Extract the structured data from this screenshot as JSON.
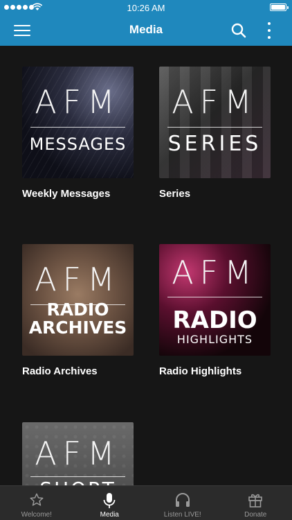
{
  "status_bar": {
    "time": "10:26 AM"
  },
  "header": {
    "title": "Media"
  },
  "media": [
    {
      "label": "Weekly Messages",
      "thumb_word": "AFM",
      "thumb_sub": [
        "MESSAGES"
      ]
    },
    {
      "label": "Series",
      "thumb_word": "AFM",
      "thumb_sub": [
        "SERIES"
      ]
    },
    {
      "label": "Radio Archives",
      "thumb_word": "AFM",
      "thumb_sub": [
        "RADIO",
        "ARCHIVES"
      ]
    },
    {
      "label": "Radio Highlights",
      "thumb_word": "AFM",
      "thumb_sub": [
        "RADIO",
        "HIGHLIGHTS"
      ]
    },
    {
      "label": "",
      "thumb_word": "AFM",
      "thumb_sub": [
        "SHORT"
      ]
    }
  ],
  "tabs": [
    {
      "label": "Welcome!",
      "icon": "star-icon",
      "active": false
    },
    {
      "label": "Media",
      "icon": "microphone-icon",
      "active": true
    },
    {
      "label": "Listen LIVE!",
      "icon": "headphones-icon",
      "active": false
    },
    {
      "label": "Donate",
      "icon": "gift-icon",
      "active": false
    }
  ],
  "colors": {
    "header": "#1f88bd",
    "background": "#161616",
    "tabbar": "#2b2b2b"
  }
}
